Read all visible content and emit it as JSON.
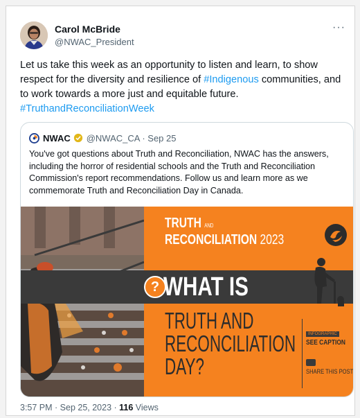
{
  "tweet": {
    "author_name": "Carol McBride",
    "author_handle": "@NWAC_President",
    "more_label": "···",
    "text_before_tag": "Let us take this week as an opportunity to listen and learn, to show respect for the diversity and resilience of ",
    "hashtag_1": "#Indigenous",
    "text_after_tag": " communities, and to work towards a more just and equitable future.",
    "hashtag_2": "#TruthandReconciliationWeek",
    "time": "3:57 PM · Sep 25, 2023 · ",
    "views_count": "116",
    "views_label": " Views"
  },
  "quote": {
    "name": "NWAC",
    "handle_date": "@NWAC_CA · Sep 25",
    "text": "You've got questions about Truth and Reconciliation, NWAC has the answers, including the horror of residential schools and the Truth and Reconciliation Commission's report recommendations. Follow us and learn more as we commemorate Truth and Reconciliation Day in Canada.",
    "graphic": {
      "title_line1": "TRUTH",
      "title_and": "AND",
      "title_line2": "RECONCILIATION",
      "year": "2023",
      "what_is": "WHAT IS",
      "question_mark": "?",
      "big_line1": "TRUTH AND",
      "big_line2": "RECONCILIATION",
      "big_line3": "DAY?",
      "tag_small": "INFOGRAPHIC",
      "see_caption": "SEE CAPTION",
      "share_post": "SHARE THIS POST"
    }
  },
  "colors": {
    "link": "#1d9bf0",
    "orange": "#f5821f",
    "dark": "#3a3a3a",
    "verified": "#e2b719"
  }
}
